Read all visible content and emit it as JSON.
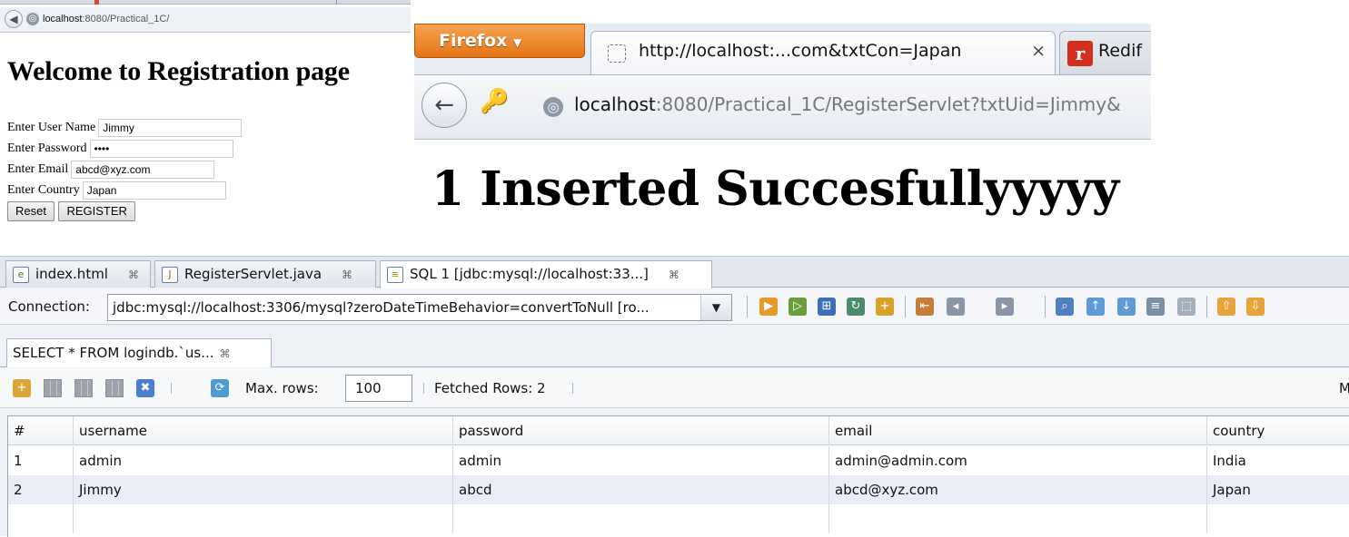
{
  "registration_window": {
    "url_host": "localhost",
    "url_rest": ":8080/Practical_1C/",
    "heading": "Welcome to Registration page",
    "fields": [
      {
        "label": "Enter User Name",
        "value": "Jimmy"
      },
      {
        "label": "Enter Password",
        "value": "••••"
      },
      {
        "label": "Enter Email",
        "value": "abcd@xyz.com"
      },
      {
        "label": "Enter Country",
        "value": "Japan"
      }
    ],
    "reset_label": "Reset",
    "register_label": "REGISTER"
  },
  "result_window": {
    "firefox_label": "Firefox",
    "tab1_title": "http://localhost:...com&txtCon=Japan",
    "tab1_close": "×",
    "tab2_title": "Redif",
    "tab2_logo": "r",
    "url_host": "localhost",
    "url_rest": ":8080/Practical_1C/RegisterServlet?txtUid=Jimmy&",
    "message": "1 Inserted Succesfullyyyyy"
  },
  "ide": {
    "editor_tabs": [
      {
        "label": "index.html",
        "icon": "html-file-icon"
      },
      {
        "label": "RegisterServlet.java",
        "icon": "java-file-icon"
      },
      {
        "label": "SQL 1 [jdbc:mysql://localhost:33...]",
        "icon": "sql-file-icon"
      }
    ],
    "tab_close": "⌘",
    "connection_label": "Connection:",
    "connection_value": "jdbc:mysql://localhost:3306/mysql?zeroDateTimeBehavior=convertToNull [ro...",
    "result_tab": "SELECT * FROM logindb.`us...",
    "max_rows_label": "Max. rows:",
    "max_rows_value": "100",
    "fetched_rows": "Fetched Rows: 2",
    "trailing_label": "M",
    "columns": [
      "#",
      "username",
      "password",
      "email",
      "country"
    ],
    "rows": [
      [
        "1",
        "admin",
        "admin",
        "admin@admin.com",
        "India"
      ],
      [
        "2",
        "Jimmy",
        "abcd",
        "abcd@xyz.com",
        "Japan"
      ]
    ]
  }
}
